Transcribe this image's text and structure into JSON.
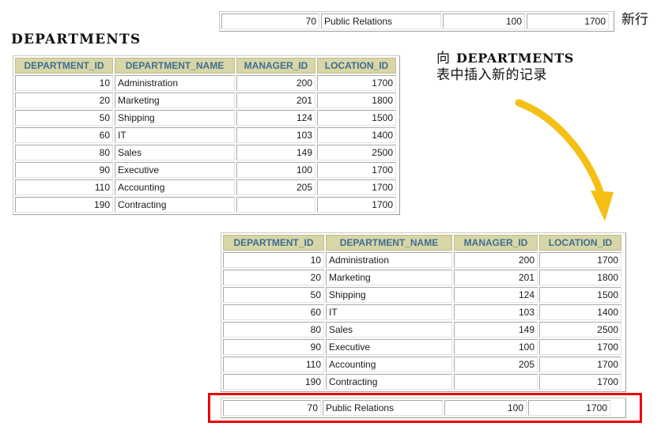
{
  "page_title": "DEPARTMENTS",
  "new_row_label": "新行",
  "annotation": {
    "line1_cn": "向",
    "line1_table": "DEPARTMENTS",
    "line2": "表中插入新的记录"
  },
  "colors": {
    "header_background": "#d8d5a6",
    "header_text": "#3d6f92",
    "cell_border": "#b8b8b8",
    "highlight_border": "#ee0000",
    "arrow": "#f5bf16",
    "page_background": "#ffffff"
  },
  "icons": {
    "arrow": "curved-down-arrow-icon"
  },
  "columns": [
    "DEPARTMENT_ID",
    "DEPARTMENT_NAME",
    "MANAGER_ID",
    "LOCATION_ID"
  ],
  "new_row": {
    "department_id": "70",
    "department_name": "Public Relations",
    "manager_id": "100",
    "location_id": "1700"
  },
  "table_before": {
    "rows": [
      {
        "department_id": "10",
        "department_name": "Administration",
        "manager_id": "200",
        "location_id": "1700"
      },
      {
        "department_id": "20",
        "department_name": "Marketing",
        "manager_id": "201",
        "location_id": "1800"
      },
      {
        "department_id": "50",
        "department_name": "Shipping",
        "manager_id": "124",
        "location_id": "1500"
      },
      {
        "department_id": "60",
        "department_name": "IT",
        "manager_id": "103",
        "location_id": "1400"
      },
      {
        "department_id": "80",
        "department_name": "Sales",
        "manager_id": "149",
        "location_id": "2500"
      },
      {
        "department_id": "90",
        "department_name": "Executive",
        "manager_id": "100",
        "location_id": "1700"
      },
      {
        "department_id": "110",
        "department_name": "Accounting",
        "manager_id": "205",
        "location_id": "1700"
      },
      {
        "department_id": "190",
        "department_name": "Contracting",
        "manager_id": "",
        "location_id": "1700"
      }
    ]
  },
  "table_after": {
    "rows": [
      {
        "department_id": "10",
        "department_name": "Administration",
        "manager_id": "200",
        "location_id": "1700"
      },
      {
        "department_id": "20",
        "department_name": "Marketing",
        "manager_id": "201",
        "location_id": "1800"
      },
      {
        "department_id": "50",
        "department_name": "Shipping",
        "manager_id": "124",
        "location_id": "1500"
      },
      {
        "department_id": "60",
        "department_name": "IT",
        "manager_id": "103",
        "location_id": "1400"
      },
      {
        "department_id": "80",
        "department_name": "Sales",
        "manager_id": "149",
        "location_id": "2500"
      },
      {
        "department_id": "90",
        "department_name": "Executive",
        "manager_id": "100",
        "location_id": "1700"
      },
      {
        "department_id": "110",
        "department_name": "Accounting",
        "manager_id": "205",
        "location_id": "1700"
      },
      {
        "department_id": "190",
        "department_name": "Contracting",
        "manager_id": "",
        "location_id": "1700"
      }
    ],
    "inserted_row": {
      "department_id": "70",
      "department_name": "Public Relations",
      "manager_id": "100",
      "location_id": "1700"
    }
  }
}
